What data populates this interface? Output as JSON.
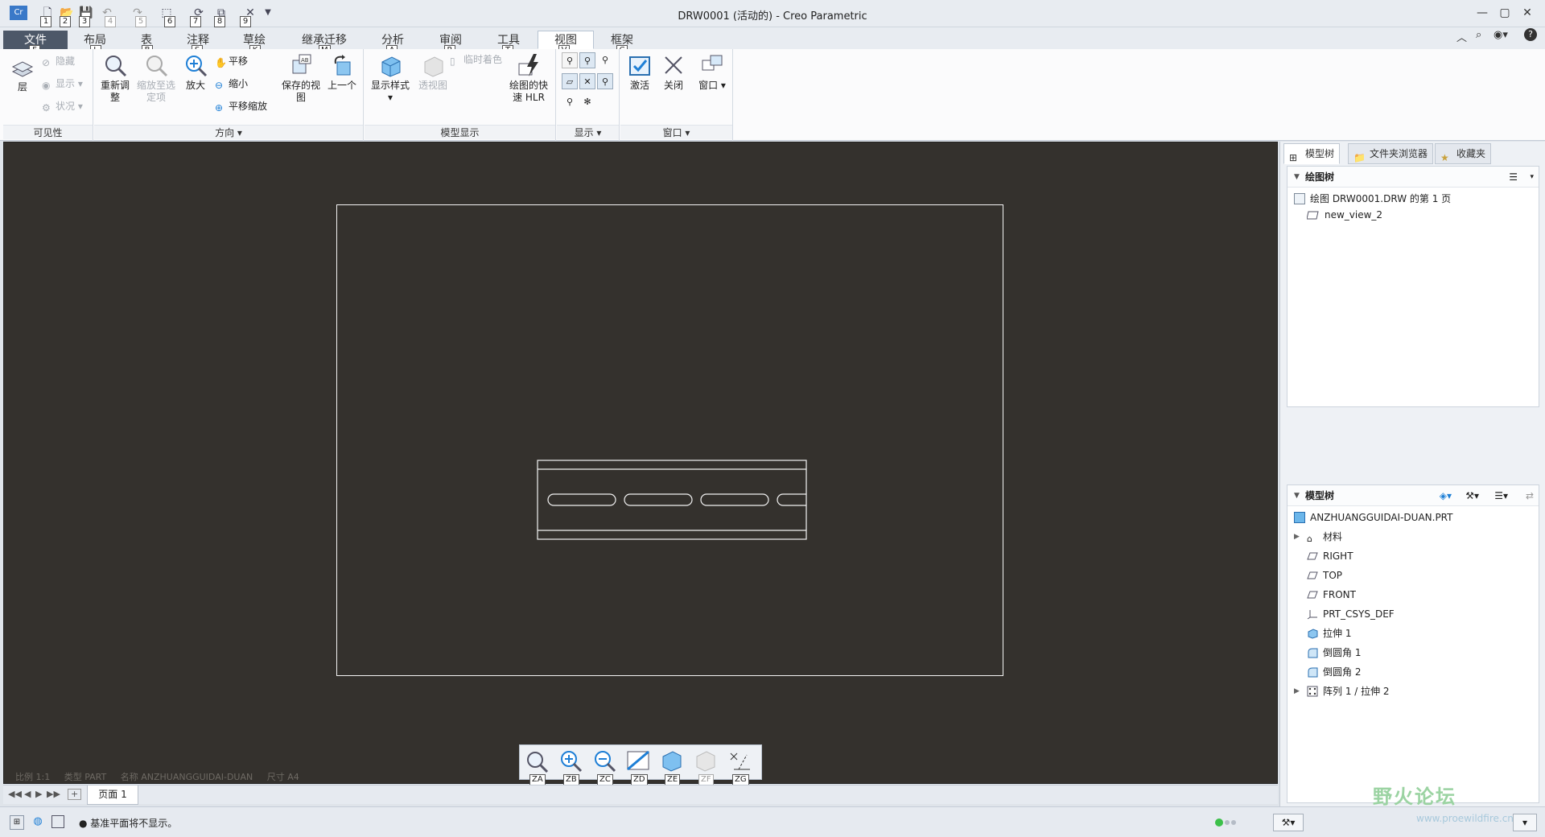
{
  "window": {
    "title": "DRW0001 (活动的) - Creo Parametric",
    "quick_access_keytips": [
      "1",
      "2",
      "3",
      "4",
      "5",
      "6",
      "7",
      "8",
      "9"
    ]
  },
  "tabs": [
    {
      "label": "文件",
      "key": "F"
    },
    {
      "label": "布局",
      "key": "L"
    },
    {
      "label": "表",
      "key": "B"
    },
    {
      "label": "注释",
      "key": "S"
    },
    {
      "label": "草绘",
      "key": "K"
    },
    {
      "label": "继承迁移",
      "key": "M"
    },
    {
      "label": "分析",
      "key": "A"
    },
    {
      "label": "审阅",
      "key": "R"
    },
    {
      "label": "工具",
      "key": "T"
    },
    {
      "label": "视图",
      "key": "V"
    },
    {
      "label": "框架",
      "key": "C"
    }
  ],
  "active_tab": "视图",
  "ribbon": {
    "visibility": {
      "label": "可见性",
      "layer": "层",
      "hide": "隐藏",
      "show": "显示",
      "status": "状况"
    },
    "orientation": {
      "label": "方向",
      "refit": "重新调整",
      "zoom_to_selected": "缩放至选定项",
      "zoom_in": "放大",
      "pan": "平移",
      "zoom_out": "缩小",
      "pan_zoom": "平移缩放",
      "saved_views": "保存的视图",
      "previous": "上一个"
    },
    "model_display": {
      "label": "模型显示",
      "display_style": "显示样式",
      "perspective": "透视图",
      "temp_shading": "临时着色",
      "fast_hlr": "绘图的快速 HLR"
    },
    "show": {
      "label": "显示"
    },
    "window": {
      "label": "窗口",
      "activate": "激活",
      "close": "关闭",
      "window": "窗口"
    }
  },
  "graphics": {
    "status_scale": "比例 1:1",
    "status_type": "类型 PART",
    "status_name": "名称 ANZHUANGGUIDAI-DUAN",
    "status_size": "尺寸 A4",
    "zoom_keytips": [
      "ZA",
      "ZB",
      "ZC",
      "ZD",
      "ZE",
      "ZF",
      "ZG"
    ]
  },
  "page_tab": "页面 1",
  "status_message": "● 基准平面将不显示。",
  "panel": {
    "tabs": [
      "模型树",
      "文件夹浏览器",
      "收藏夹"
    ],
    "drawing_tree": {
      "header": "绘图树",
      "items": [
        "绘图 DRW0001.DRW 的第 1 页",
        "new_view_2"
      ]
    },
    "model_tree": {
      "header": "模型树",
      "items": [
        "ANZHUANGGUIDAI-DUAN.PRT",
        "材料",
        "RIGHT",
        "TOP",
        "FRONT",
        "PRT_CSYS_DEF",
        "拉伸 1",
        "倒圆角 1",
        "倒圆角 2",
        "阵列 1 / 拉伸 2"
      ]
    }
  },
  "watermark": {
    "text": "野火论坛",
    "url": "www.proewildfire.cn"
  },
  "colors": {
    "canvas": "#34312d",
    "file_tab": "#4d5868",
    "accent": "#1e7fd6"
  }
}
